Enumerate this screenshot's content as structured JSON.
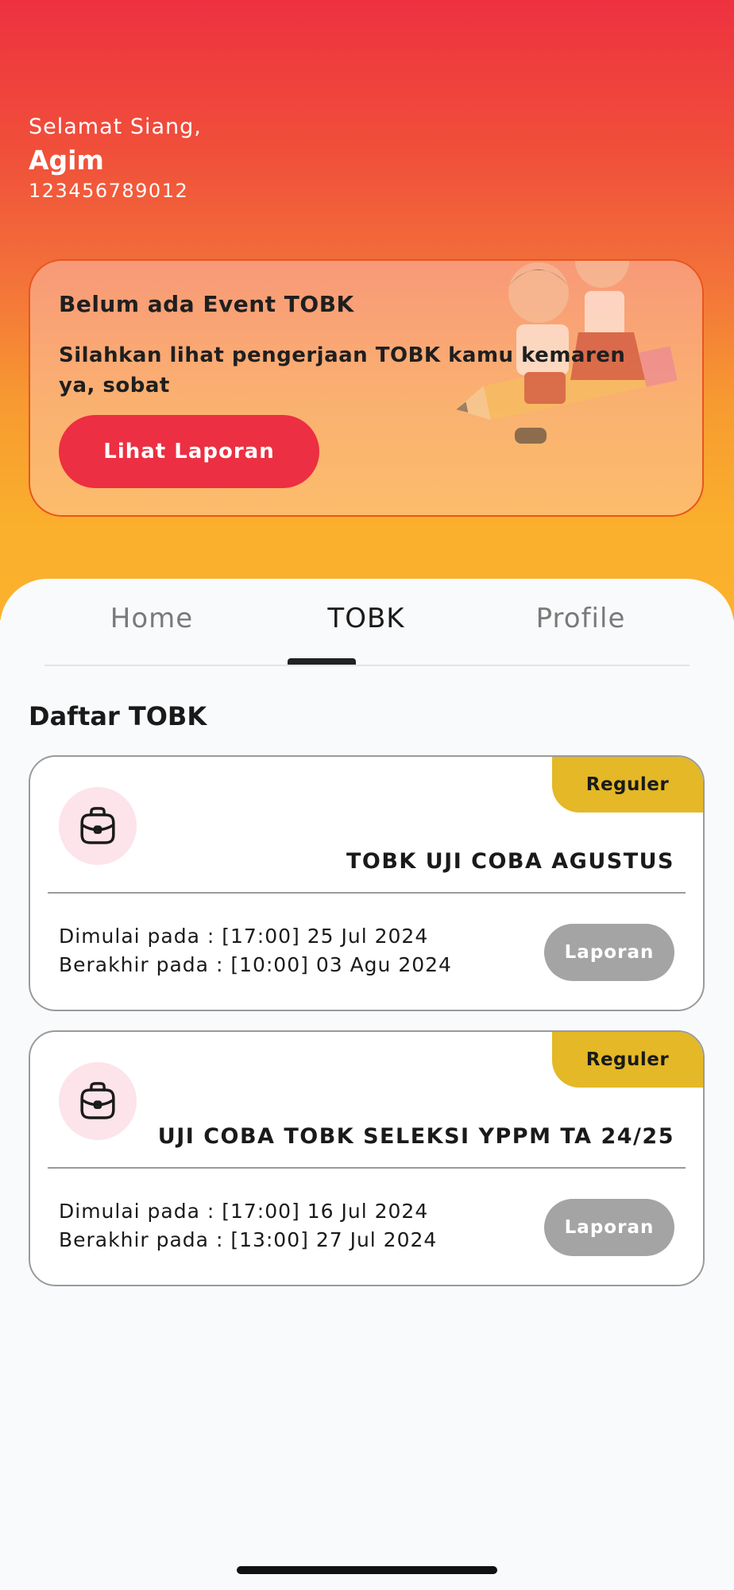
{
  "greeting": {
    "hello": "Selamat Siang,",
    "name": "Agim",
    "id": "123456789012"
  },
  "event_banner": {
    "title": "Belum ada Event TOBK",
    "message": "Silahkan lihat pengerjaan TOBK kamu kemaren ya, sobat",
    "button_label": "Lihat Laporan"
  },
  "tabs": [
    {
      "label": "Home",
      "active": false
    },
    {
      "label": "TOBK",
      "active": true
    },
    {
      "label": "Profile",
      "active": false
    }
  ],
  "section_title": "Daftar TOBK",
  "tobk_list": [
    {
      "badge": "Reguler",
      "title": "TOBK UJI COBA AGUSTUS",
      "start": "Dimulai pada : [17:00] 25 Jul 2024",
      "end": "Berakhir pada : [10:00] 03 Agu 2024",
      "button_label": "Laporan",
      "icon": "briefcase-icon"
    },
    {
      "badge": "Reguler",
      "title": "UJI COBA TOBK SELEKSI YPPM TA 24/25",
      "start": "Dimulai pada : [17:00] 16 Jul 2024",
      "end": "Berakhir pada : [13:00] 27 Jul 2024",
      "button_label": "Laporan",
      "icon": "briefcase-icon"
    }
  ],
  "colors": {
    "accent_red": "#ec2f42",
    "badge_yellow": "#e4b826",
    "disabled_gray": "#a4a4a4"
  }
}
